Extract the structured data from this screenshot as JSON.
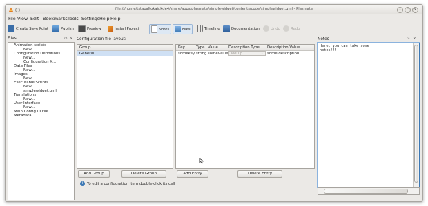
{
  "window": {
    "title": "file:///home/tstapaltokai/.kde4/share/apps/plasmate/simplewidget/contents/code/simplewidget.qml - Plasmate",
    "controls": [
      "minimize",
      "maximize",
      "close"
    ]
  },
  "menubar": {
    "items": [
      "File",
      "View",
      "Edit",
      "Bookmarks",
      "Tools",
      "Settings",
      "Help",
      "Help"
    ]
  },
  "toolbar": {
    "create_save_point": "Create Save Point",
    "publish": "Publish",
    "preview": "Preview",
    "install_project": "Install Project",
    "notes": "Notes",
    "files": "Files",
    "timeline": "Timeline",
    "documentation": "Documentation",
    "undo": "Undo",
    "redo": "Redo"
  },
  "files_panel": {
    "title": "Files",
    "tree": [
      "Animation scripts",
      "New...",
      "Configuration Definitions",
      "New...",
      "Configuration X...",
      "Data Files",
      "New...",
      "Images",
      "New...",
      "Executable Scripts",
      "New...",
      "simplewidget.qml",
      "Translations",
      "New...",
      "User Interface",
      "New...",
      "Main Config UI File",
      "Metadata"
    ]
  },
  "config_layout": {
    "title": "Configuration file layout:",
    "groups_header": "Group",
    "groups": [
      "General"
    ],
    "entries_headers": [
      "Key",
      "Type",
      "Value",
      "Description Type",
      "Description Value"
    ],
    "entries": [
      {
        "key": "somekey",
        "type": "string",
        "value": "someValue",
        "description_type": "ToolTip",
        "description_value": "some description"
      }
    ],
    "add_group": "Add Group",
    "delete_group": "Delete Group",
    "add_entry": "Add Entry",
    "delete_entry": "Delete Entry",
    "hint": "To edit a configuration item double-click its cell"
  },
  "notes_panel": {
    "title": "Notes",
    "content": "Here, you can take some\nnotes!!!!"
  },
  "colors": {
    "selection": "#cfe0f4",
    "window_bg": "#ebe9e6",
    "accent": "#3c78b4"
  }
}
